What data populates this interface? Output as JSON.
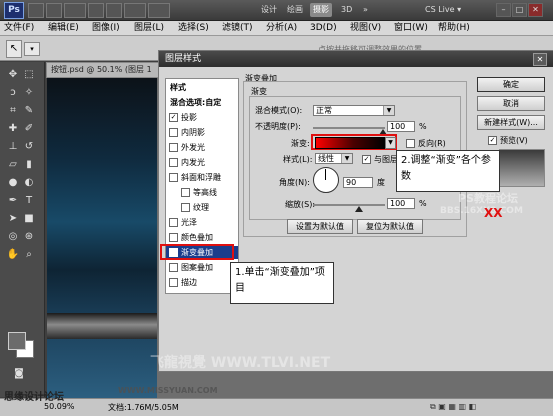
{
  "titlebar": {
    "app": "Ps",
    "workspaces": [
      "设计",
      "绘画",
      "摄影",
      "3D"
    ],
    "active_workspace": "摄影",
    "more": "»",
    "cs_live": "CS Live ▾",
    "min": "–",
    "max": "□",
    "close": "✕"
  },
  "menubar": {
    "items": [
      "文件(F)",
      "编辑(E)",
      "图像(I)",
      "图层(L)",
      "选择(S)",
      "滤镜(T)",
      "分析(A)",
      "3D(D)",
      "视图(V)",
      "窗口(W)",
      "帮助(H)"
    ]
  },
  "optbar": {
    "hint": "点按并拖移可调整效果的位置"
  },
  "document": {
    "tab": "按钮.psd @ 50.1% (图层 1",
    "zoom": "50.09%",
    "doc_info": "文档:1.76M/5.05M"
  },
  "dialog": {
    "title": "图层样式",
    "close": "✕",
    "styles": [
      {
        "label": "样式",
        "type": "header"
      },
      {
        "label": "混合选项:自定",
        "type": "header"
      },
      {
        "label": "投影",
        "checked": true
      },
      {
        "label": "内阴影",
        "checked": false
      },
      {
        "label": "外发光",
        "checked": false
      },
      {
        "label": "内发光",
        "checked": false
      },
      {
        "label": "斜面和浮雕",
        "checked": false
      },
      {
        "label": "等高线",
        "checked": false,
        "sub": true
      },
      {
        "label": "纹理",
        "checked": false,
        "sub": true
      },
      {
        "label": "光泽",
        "checked": false
      },
      {
        "label": "颜色叠加",
        "checked": false
      },
      {
        "label": "渐变叠加",
        "checked": true,
        "selected": true
      },
      {
        "label": "图案叠加",
        "checked": false
      },
      {
        "label": "描边",
        "checked": false
      }
    ],
    "section_title": "渐变叠加",
    "subsection_title": "渐变",
    "blend_mode_label": "混合模式(O):",
    "blend_mode_value": "正常",
    "opacity_label": "不透明度(P):",
    "opacity_value": "100",
    "percent": "%",
    "gradient_label": "渐变:",
    "reverse_label": "反向(R)",
    "style_label": "样式(L):",
    "style_value": "线性",
    "align_label": "与图层",
    "angle_label": "角度(N):",
    "angle_value": "90",
    "degree": "度",
    "scale_label": "缩放(S):",
    "scale_value": "100",
    "default_btn": "设置为默认值",
    "reset_btn": "复位为默认值",
    "ok_btn": "确定",
    "cancel_btn": "取消",
    "new_style_btn": "新建样式(W)...",
    "preview_label": "预览(V)",
    "preview_checked": true
  },
  "annotations": {
    "note1": "1.单击“渐变叠加”项目",
    "note2": "2.调整“渐变”各个参数"
  },
  "watermarks": {
    "forum": "思缘设计论坛",
    "site1": "WWW.MISSYUAN.COM",
    "tlvi": "飞龍視覺 WWW.TLVI.NET",
    "pps": "PS教程论坛",
    "pps_url": "BBS.16XX8.COM",
    "xx": "XX"
  },
  "colors": {
    "accent_red": "#e01010",
    "selection_blue": "#1b3d8c"
  }
}
